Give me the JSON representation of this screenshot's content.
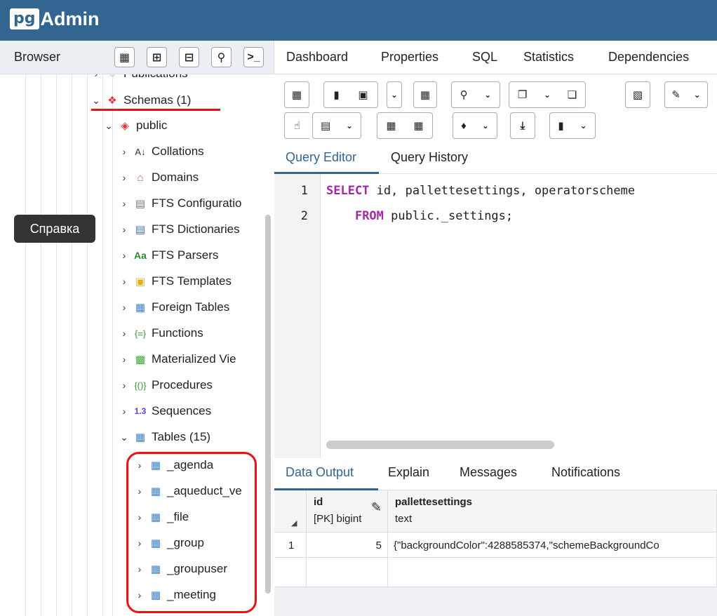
{
  "app": {
    "logo_pg": "pg",
    "logo_text": "Admin"
  },
  "browser": {
    "title": "Browser",
    "tooltip": "Справка"
  },
  "tree": {
    "cut_item": "Publications",
    "schemas": "Schemas (1)",
    "public": "public",
    "items": [
      {
        "label": "Collations",
        "icon": "collation-icon"
      },
      {
        "label": "Domains",
        "icon": "domain-icon"
      },
      {
        "label": "FTS Configuratio",
        "icon": "fts-config-icon"
      },
      {
        "label": "FTS Dictionaries",
        "icon": "fts-dictionary-icon"
      },
      {
        "label": "FTS Parsers",
        "icon": "fts-parser-icon"
      },
      {
        "label": "FTS Templates",
        "icon": "fts-template-icon"
      },
      {
        "label": "Foreign Tables",
        "icon": "foreign-table-icon"
      },
      {
        "label": "Functions",
        "icon": "function-icon"
      },
      {
        "label": "Materialized Vie",
        "icon": "materialized-view-icon"
      },
      {
        "label": "Procedures",
        "icon": "procedure-icon"
      },
      {
        "label": "Sequences",
        "icon": "sequence-icon"
      },
      {
        "label": "Tables (15)",
        "icon": "tables-icon"
      }
    ],
    "tables": [
      "_agenda",
      "_aqueduct_ve",
      "_file",
      "_group",
      "_groupuser",
      "_meeting"
    ]
  },
  "main_tabs": [
    "Dashboard",
    "Properties",
    "SQL",
    "Statistics",
    "Dependencies"
  ],
  "editor_tabs": [
    "Query Editor",
    "Query History"
  ],
  "editor": {
    "line1_kw": "SELECT",
    "line1_rest": " id, pallettesettings, operatorscheme",
    "line2_kw": "FROM",
    "line2_rest": " public._settings;",
    "line2_kw2": "public",
    "line_numbers": [
      "1",
      "2"
    ]
  },
  "output_tabs": [
    "Data Output",
    "Explain",
    "Messages",
    "Notifications"
  ],
  "grid": {
    "columns": [
      {
        "name": "id",
        "type": "[PK] bigint"
      },
      {
        "name": "pallettesettings",
        "type": "text"
      }
    ],
    "rows": [
      {
        "num": "1",
        "id": "5",
        "pallettesettings": "{\"backgroundColor\":4288585374,\"schemeBackgroundCo"
      }
    ]
  },
  "colors": {
    "brand": "#326690",
    "annotation": "#e11111"
  }
}
